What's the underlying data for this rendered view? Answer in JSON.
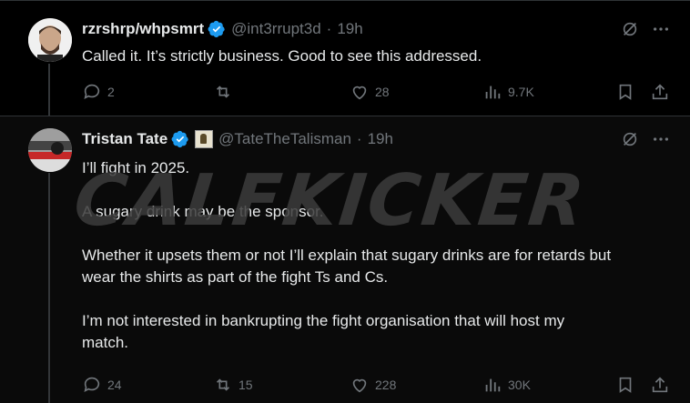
{
  "posts": [
    {
      "name": "rzrshrp/whpsmrt",
      "handle": "@int3rrupt3d",
      "time": "19h",
      "text": "Called it. It’s strictly business. Good to see this addressed.",
      "stats": {
        "replies": "2",
        "reposts": "",
        "likes": "28",
        "views": "9.7K"
      }
    },
    {
      "name": "Tristan Tate",
      "handle": "@TateTheTalisman",
      "time": "19h",
      "text": "I’ll fight in 2025.\n\nA sugary drink may be the sponsor.\n\nWhether it upsets them or not I’ll explain that sugary drinks are for retards but\nwear the shirts as part of the fight Ts and Cs.\n\nI’m not interested in bankrupting the fight organisation that will host my\nmatch.",
      "stats": {
        "replies": "24",
        "reposts": "15",
        "likes": "228",
        "views": "30K"
      }
    }
  ],
  "separator": "·",
  "watermark": "CALFKICKER",
  "colors": {
    "accent": "#1d9bf0",
    "muted": "#71767b",
    "text": "#e7e9ea",
    "background": "#000000"
  },
  "icons": [
    "verified-badge-icon",
    "grok-icon",
    "more-icon",
    "reply-icon",
    "repost-icon",
    "like-icon",
    "views-icon",
    "bookmark-icon",
    "share-icon"
  ]
}
